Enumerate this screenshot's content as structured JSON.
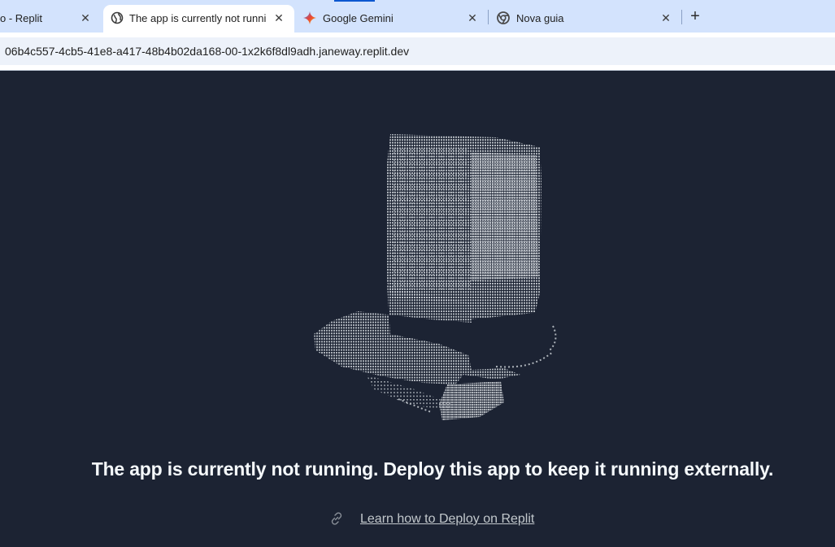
{
  "browser": {
    "tabs": [
      {
        "label": "o - Replit",
        "icon": "replit-icon",
        "close": "✕"
      },
      {
        "label": "The app is currently not running",
        "icon": "globe-icon",
        "close": "✕",
        "active": true
      },
      {
        "label": "Google Gemini",
        "icon": "gemini-sparkle-icon",
        "close": "✕"
      },
      {
        "label": "Nova guia",
        "icon": "chrome-icon",
        "close": "✕"
      }
    ],
    "new_tab": "+",
    "url": "06b4c557-4cb5-41e8-a417-48b4b02da168-00-1x2k6f8dl9adh.janeway.replit.dev"
  },
  "page": {
    "illustration": "ascii-art-sneaker",
    "headline": "The app is currently not running. Deploy this app to keep it running externally.",
    "link_text": "Learn how to Deploy on Replit",
    "link_icon": "link-icon"
  },
  "colors": {
    "tabstrip_bg": "#d3e3fd",
    "page_bg": "#1c2333",
    "headline": "#f5f9fc",
    "link": "#c2c8cc",
    "art": "#c8cdd3"
  }
}
